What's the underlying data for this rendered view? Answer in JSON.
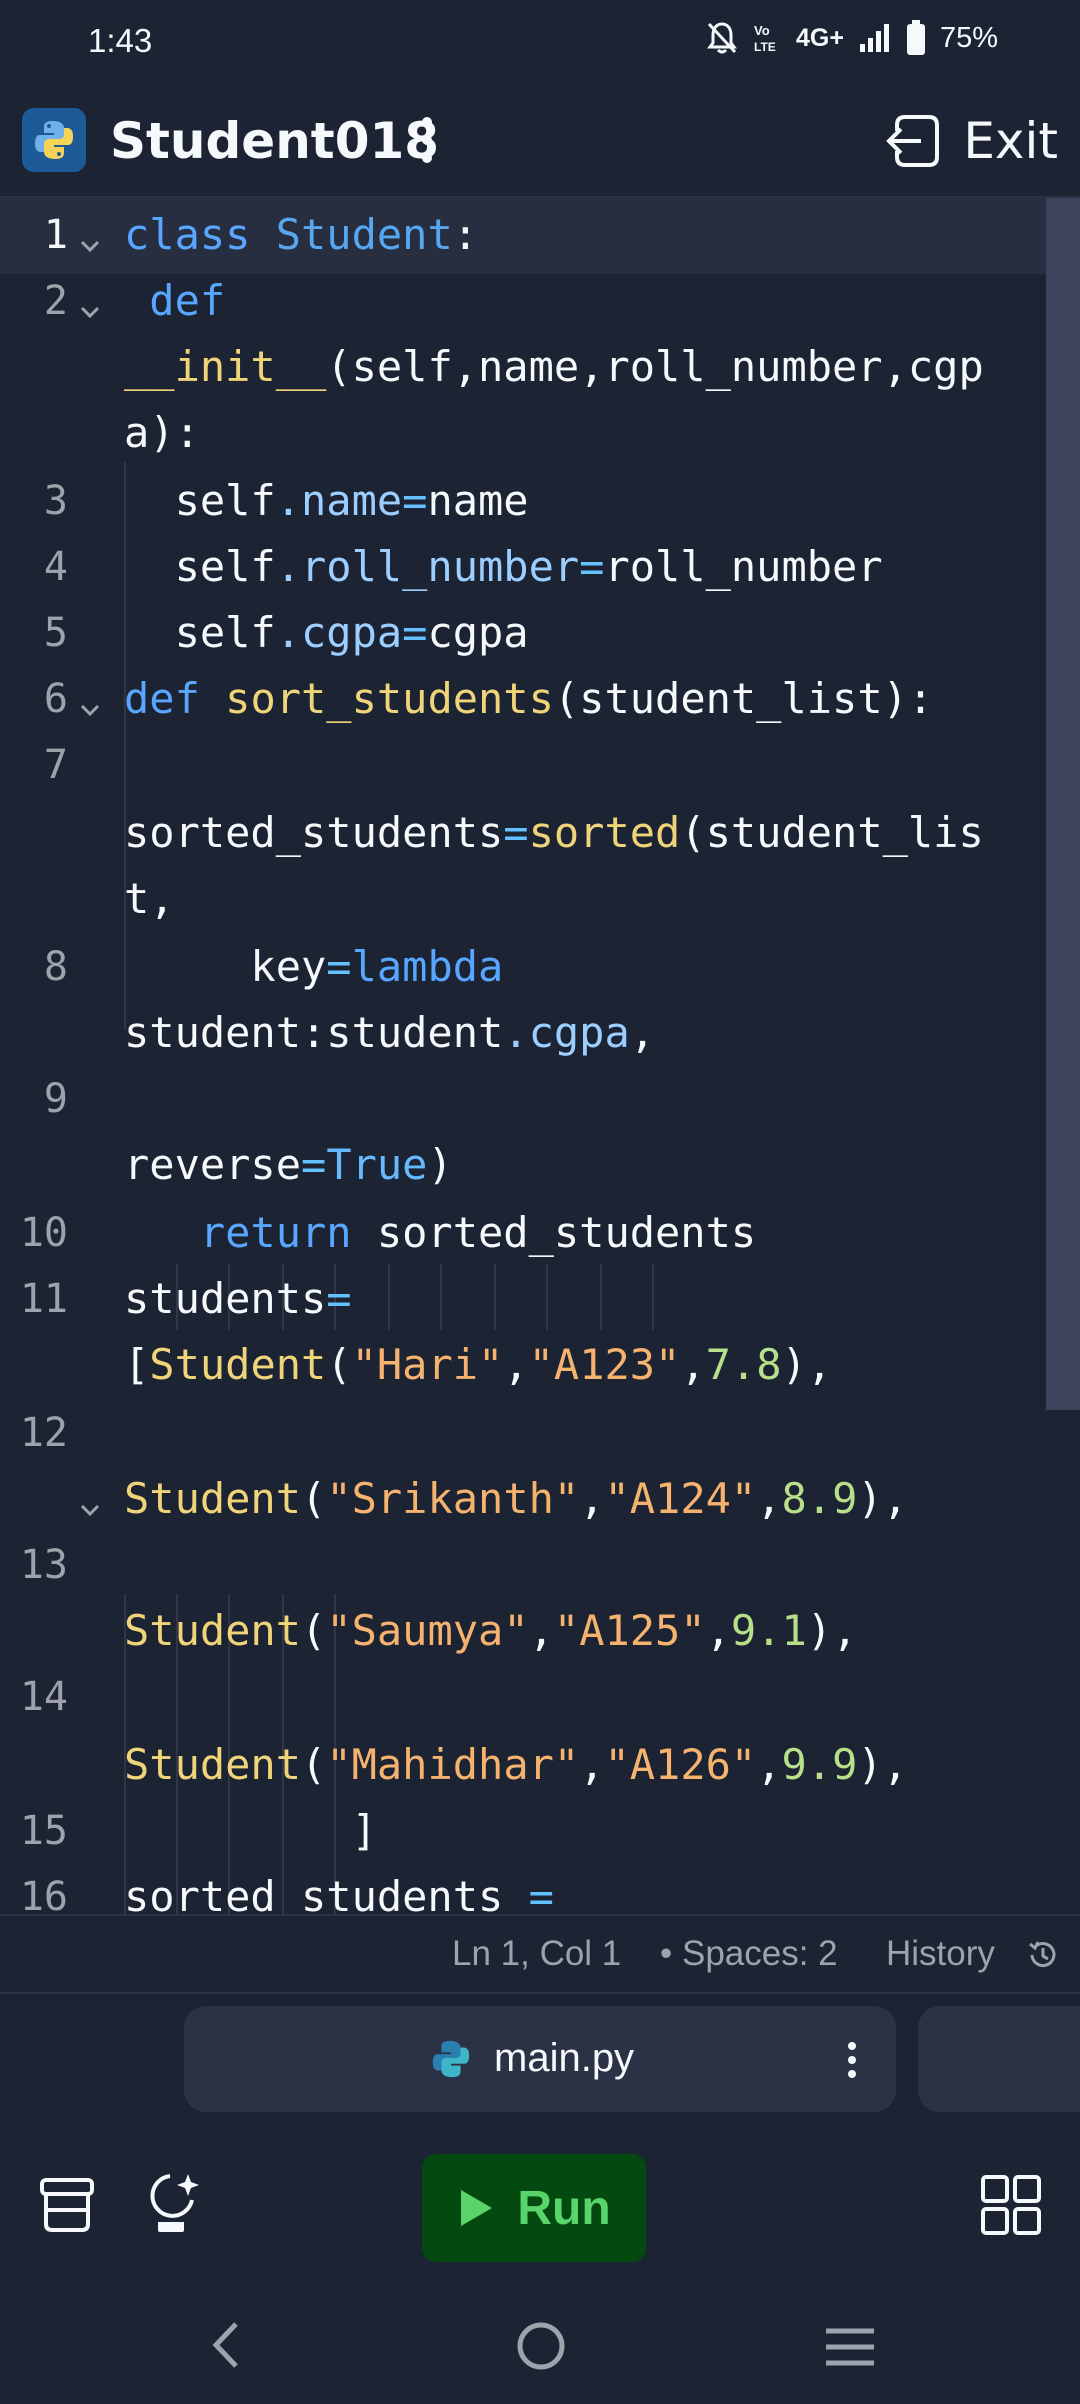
{
  "status_bar": {
    "time": "1:43",
    "network": "4G+",
    "battery": "75%",
    "icons": [
      "mute-icon",
      "volte-icon",
      "signal-icon",
      "battery-icon"
    ]
  },
  "header": {
    "title": "Student018",
    "exit_label": "Exit",
    "icons": [
      "python-logo-icon",
      "more-vertical-icon",
      "exit-icon"
    ]
  },
  "editor": {
    "line_numbers": [
      "1",
      "2",
      "3",
      "4",
      "5",
      "6",
      "7",
      "8",
      "9",
      "10",
      "11",
      "12",
      "13",
      "14",
      "15",
      "16"
    ],
    "lines": [
      "class Student:",
      " def",
      "__init__(self,name,roll_number,cgp",
      "a):",
      "  self.name=name",
      "  self.roll_number=roll_number",
      "  self.cgpa=cgpa",
      "def sort_students(student_list):",
      "sorted_students=sorted(student_lis",
      "t,",
      "     key=lambda",
      "student:student.cgpa,",
      "reverse=True)",
      "   return sorted_students",
      "students=",
      "[Student(\"Hari\",\"A123\",7.8),",
      "Student(\"Srikanth\",\"A124\",8.9),",
      "Student(\"Saumya\",\"A125\",9.1),",
      "Student(\"Mahidhar\",\"A126\",9.9),",
      "         ]",
      "sorted_students ="
    ]
  },
  "editor_status": {
    "position": "Ln 1, Col 1",
    "spaces": "• Spaces: 2",
    "history": "History"
  },
  "file_tab": {
    "label": "main.py"
  },
  "toolbar": {
    "run_label": "Run",
    "icons": [
      "database-icon",
      "ai-assistant-icon",
      "play-icon",
      "grid-icon"
    ]
  },
  "nav": {
    "icons": [
      "back-icon",
      "home-icon",
      "recents-icon"
    ]
  },
  "colors": {
    "background": "#1c2333",
    "surface": "#2b3245",
    "run_bg": "#044a10",
    "run_fg": "#58d46a",
    "keyword": "#58a6ff",
    "function": "#f0d47a",
    "string": "#f5b36f",
    "number": "#b8e08a"
  }
}
